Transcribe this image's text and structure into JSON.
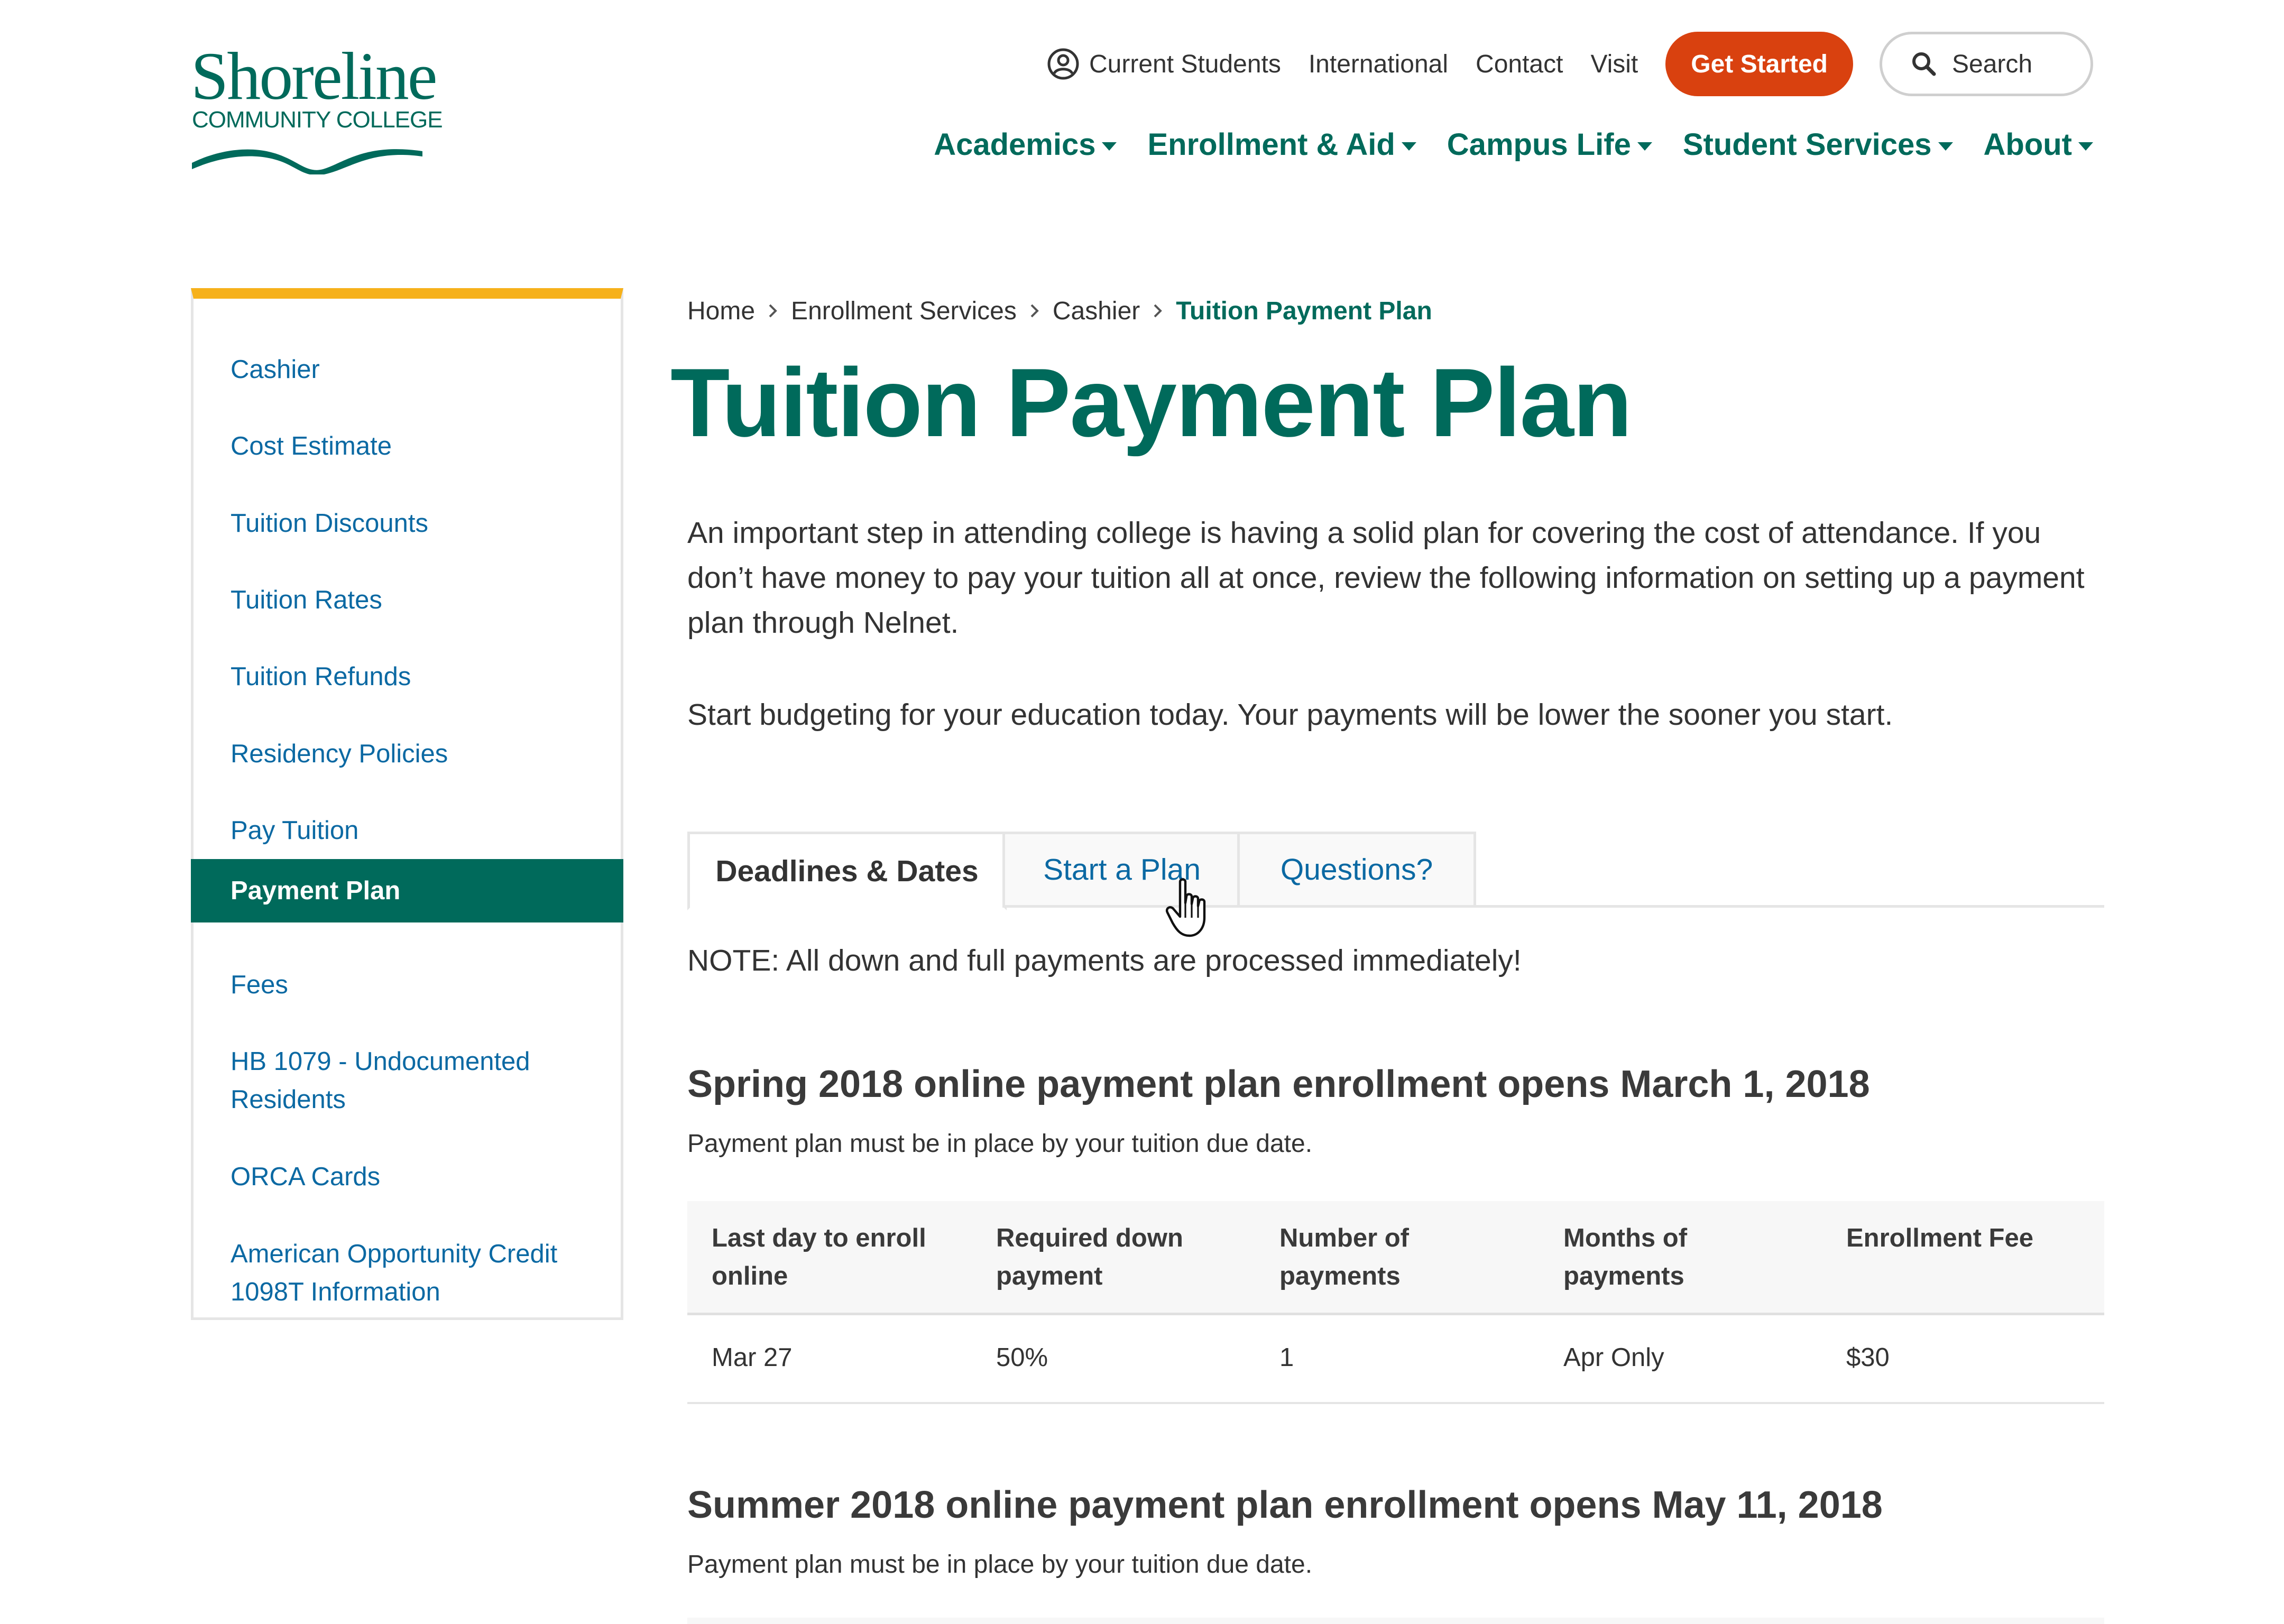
{
  "brand": {
    "name": "Shoreline",
    "subtitle": "COMMUNITY COLLEGE",
    "color": "#006a5b"
  },
  "utility_nav": {
    "current_students": "Current Students",
    "current_students_icon": "user-circle-icon",
    "international": "International",
    "contact": "Contact",
    "visit": "Visit",
    "get_started": "Get Started",
    "search_label": "Search",
    "search_icon": "search-icon",
    "accent_color": "#d9410f"
  },
  "main_nav": [
    {
      "label": "Academics"
    },
    {
      "label": "Enrollment & Aid"
    },
    {
      "label": "Campus Life"
    },
    {
      "label": "Student Services"
    },
    {
      "label": "About"
    }
  ],
  "sidebar": {
    "accent_color": "#f6b11b",
    "items": [
      {
        "label": "Cashier"
      },
      {
        "label": "Cost Estimate"
      },
      {
        "label": "Tuition Discounts"
      },
      {
        "label": "Tuition Rates"
      },
      {
        "label": "Tuition Refunds"
      },
      {
        "label": "Residency Policies"
      },
      {
        "label": "Pay Tuition"
      },
      {
        "label": "Payment Plan",
        "active": true
      },
      {
        "label": "Fees"
      },
      {
        "label": "HB 1079 - Undocumented Residents"
      },
      {
        "label": "ORCA Cards"
      },
      {
        "label": "American Opportunity Credit 1098T Information"
      }
    ]
  },
  "breadcrumb": {
    "items": [
      "Home",
      "Enrollment Services",
      "Cashier"
    ],
    "current": "Tuition Payment Plan"
  },
  "page": {
    "title": "Tuition Payment Plan",
    "intro": "An important step in attending college is having a solid plan for covering the cost of attendance. If you don’t have money to pay your tuition all at once, review the following information on setting up a payment plan through Nelnet.",
    "intro2": "Start budgeting for your education today. Your payments will be lower the sooner you start."
  },
  "tabs": [
    {
      "label": "Deadlines & Dates",
      "selected": true
    },
    {
      "label": "Start a Plan",
      "selected": false
    },
    {
      "label": "Questions?",
      "selected": false
    }
  ],
  "note": "NOTE: All down and full payments are processed immediately!",
  "sections": [
    {
      "title": "Spring 2018 online payment plan enrollment opens March 1, 2018",
      "subtitle": "Payment plan must be in place by your tuition due date.",
      "table": {
        "headers": [
          "Last day to enroll online",
          "Required down payment",
          "Number of payments",
          "Months of payments",
          "Enrollment Fee"
        ],
        "rows": [
          [
            "Mar 27",
            "50%",
            "1",
            "Apr Only",
            "$30"
          ]
        ]
      }
    },
    {
      "title": "Summer 2018 online payment plan enrollment opens May 11, 2018",
      "subtitle": "Payment plan must be in place by your tuition due date."
    }
  ]
}
